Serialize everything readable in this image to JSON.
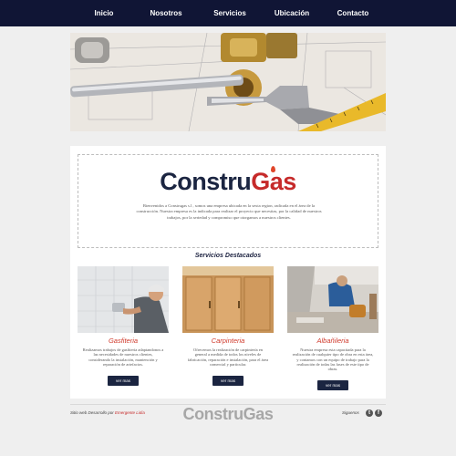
{
  "nav": {
    "items": [
      {
        "label": "Inicio"
      },
      {
        "label": "Nosotros"
      },
      {
        "label": "Servicios"
      },
      {
        "label": "Ubicación"
      },
      {
        "label": "Contacto"
      }
    ]
  },
  "intro": {
    "logo_part1": "Constru",
    "logo_part2": "Gas",
    "text": "Bienvenidos a Construgas s.l , somos una empresa ubicada en la sexta region, radicada en el área de la construcción. Nuestra empresa es la indicada para realizar el proyecto que necesitas, por la calidad de nuestros trabajos, por la seriedad y compromiso que otorgamos a nuestros clientes."
  },
  "services": {
    "title": "Servicios Destacados",
    "cards": [
      {
        "title": "Gasfiteria",
        "text": "Realizamos trabajos de gasfitería adaptandonos a las necesidades de nuestros clientes, considerando la instalación, mantención y reparación de artefactos.",
        "button": "ver mas"
      },
      {
        "title": "Carpinteria",
        "text": "Ofrecemos la realización de carpintería en general a medida de todos los niveles de fabricación, reparación e instalación, para el área comercial y particular.",
        "button": "ver mas"
      },
      {
        "title": "Albañileria",
        "text": "Nuestra empresa esta capacitada para la realización de cualquier tipo de obra en esta área, y contamos con un equipo de trabajo para la realización de todas las fases de este tipo de obras.",
        "button": "ver mas"
      }
    ]
  },
  "footer": {
    "credit_prefix": "Sitio web Desarrollo por",
    "credit_author": "Emergente Lidia",
    "logo": "ConstruGas",
    "follow": "Siguenos",
    "social": [
      {
        "icon": "twitter-icon",
        "glyph": "t"
      },
      {
        "icon": "facebook-icon",
        "glyph": "f"
      }
    ]
  },
  "colors": {
    "nav_bg": "#101535",
    "brand_dark": "#1b2541",
    "brand_red": "#c62a2a"
  }
}
